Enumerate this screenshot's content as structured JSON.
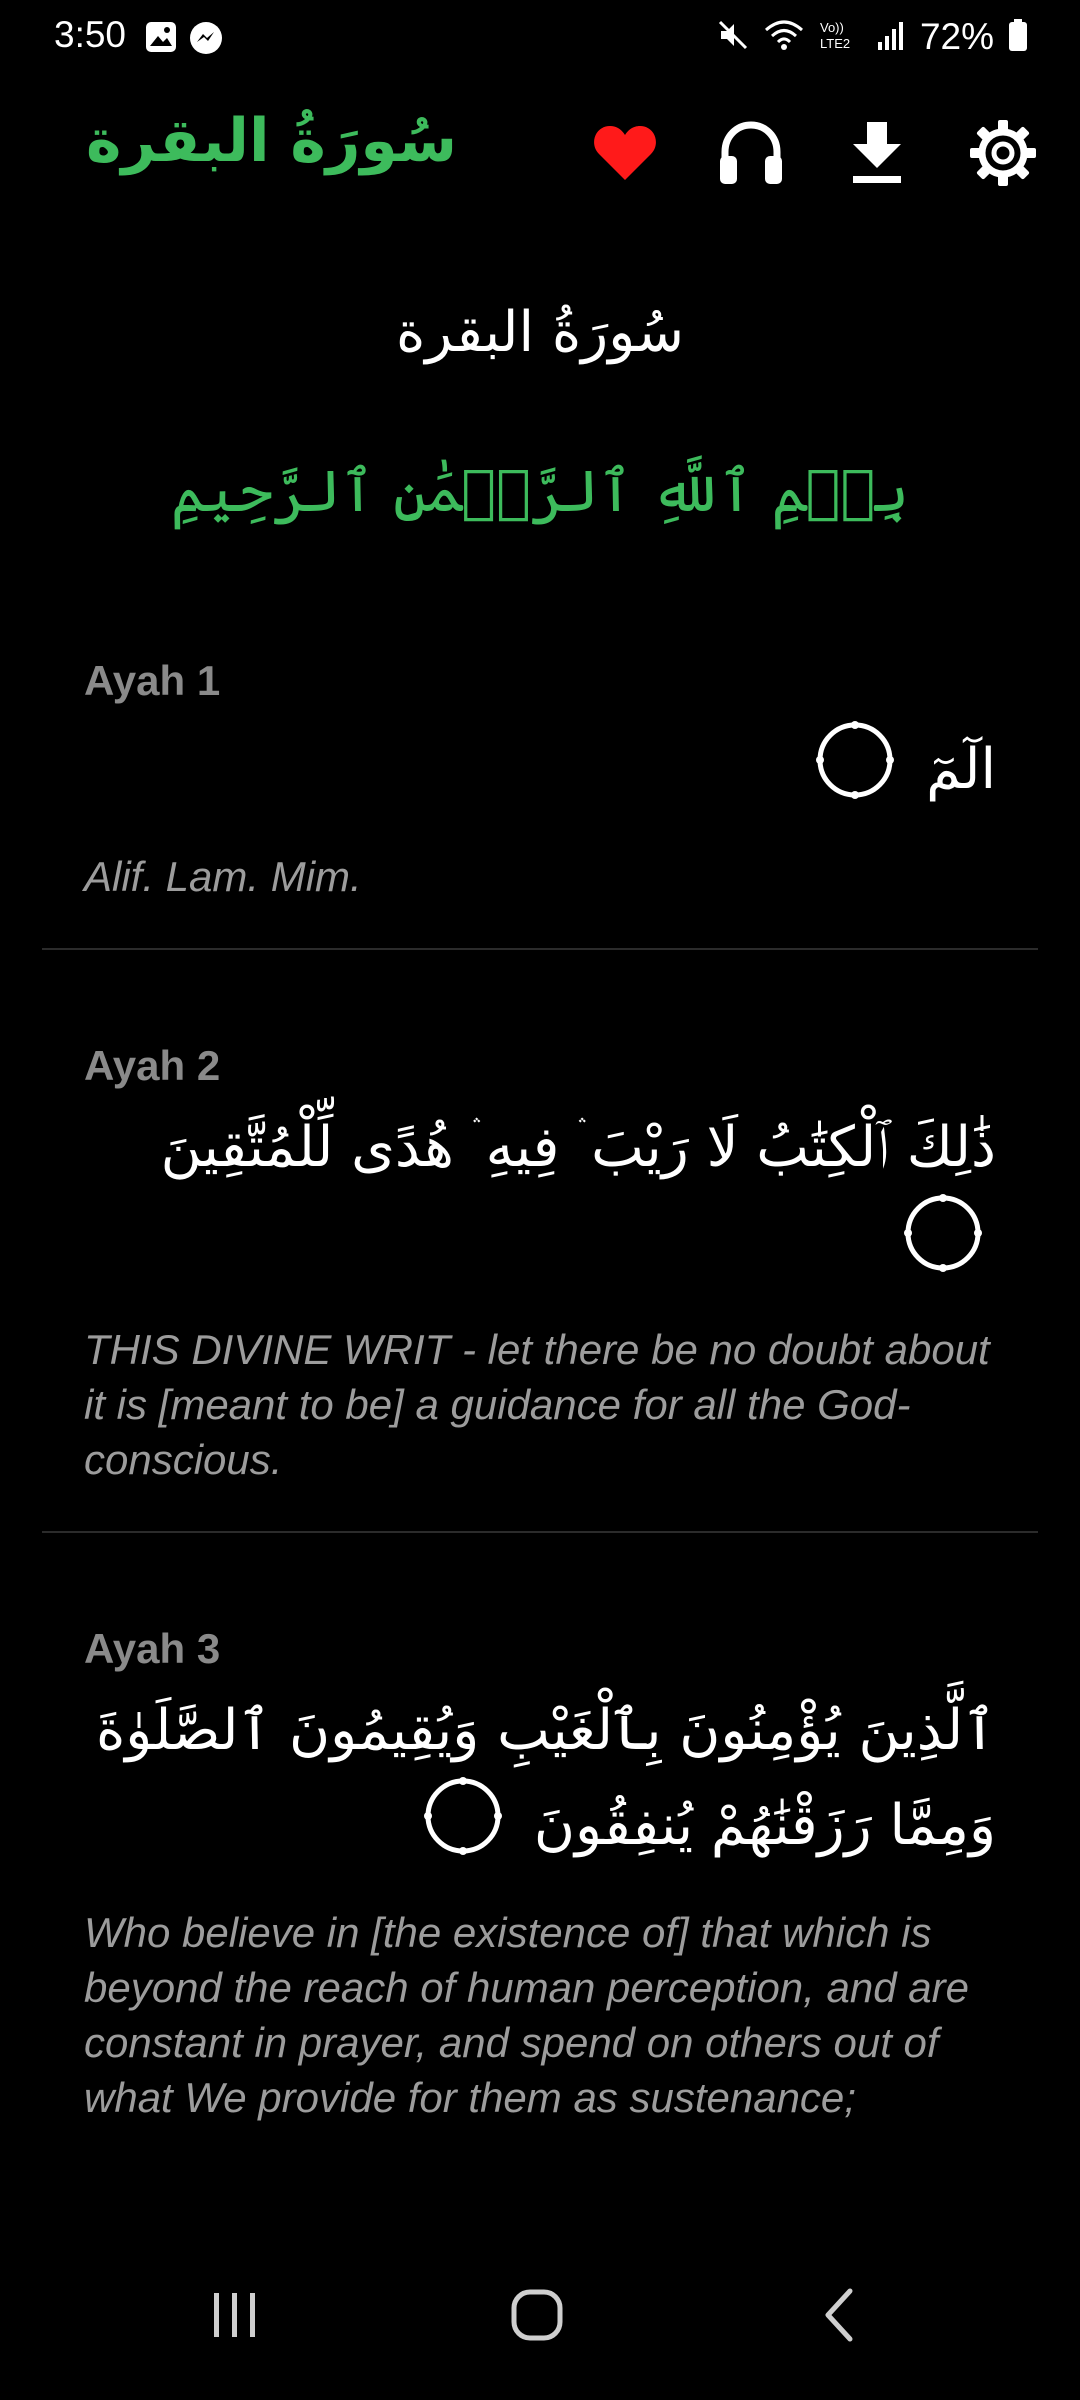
{
  "status_bar": {
    "time": "3:50",
    "battery": "72%",
    "icons": [
      "gallery-icon",
      "messenger-icon",
      "mute-icon",
      "wifi-icon",
      "lte-icon",
      "signal-icon",
      "battery-icon"
    ]
  },
  "app_bar": {
    "title": "سُورَةُ البقرة",
    "actions": [
      "heart-icon",
      "headphones-icon",
      "download-icon",
      "settings-icon"
    ],
    "colors": {
      "title": "#3dbb5c",
      "heart": "#ff1a1a"
    }
  },
  "surah": {
    "heading": "سُورَةُ البقرة",
    "bismillah": "بِسۡمِ ٱللَّهِ ٱلرَّحۡمَٰنِ ٱلرَّحِيمِ"
  },
  "ayahs": [
    {
      "label": "Ayah 1",
      "arabic": "الٓمٓ",
      "translation": "Alif. Lam. Mim."
    },
    {
      "label": "Ayah 2",
      "arabic": "ذَٰلِكَ ٱلْكِتَٰبُ لَا رَيْبَ ۛ فِيهِ ۛ هُدًى لِّلْمُتَّقِينَ",
      "translation": "THIS DIVINE WRIT - let there be no doubt about it is [meant to be] a guidance for all the God-conscious."
    },
    {
      "label": "Ayah 3",
      "arabic": "ٱلَّذِينَ يُؤْمِنُونَ بِٱلْغَيْبِ وَيُقِيمُونَ ٱلصَّلَوٰةَ وَمِمَّا رَزَقْنَٰهُمْ يُنفِقُونَ",
      "translation": "Who believe in [the existence of] that which is beyond the reach of human perception, and are constant in prayer, and spend on others out of what We provide for them as sustenance;"
    }
  ],
  "nav_bar": {
    "buttons": [
      "recent-apps-icon",
      "home-icon",
      "back-icon"
    ]
  }
}
